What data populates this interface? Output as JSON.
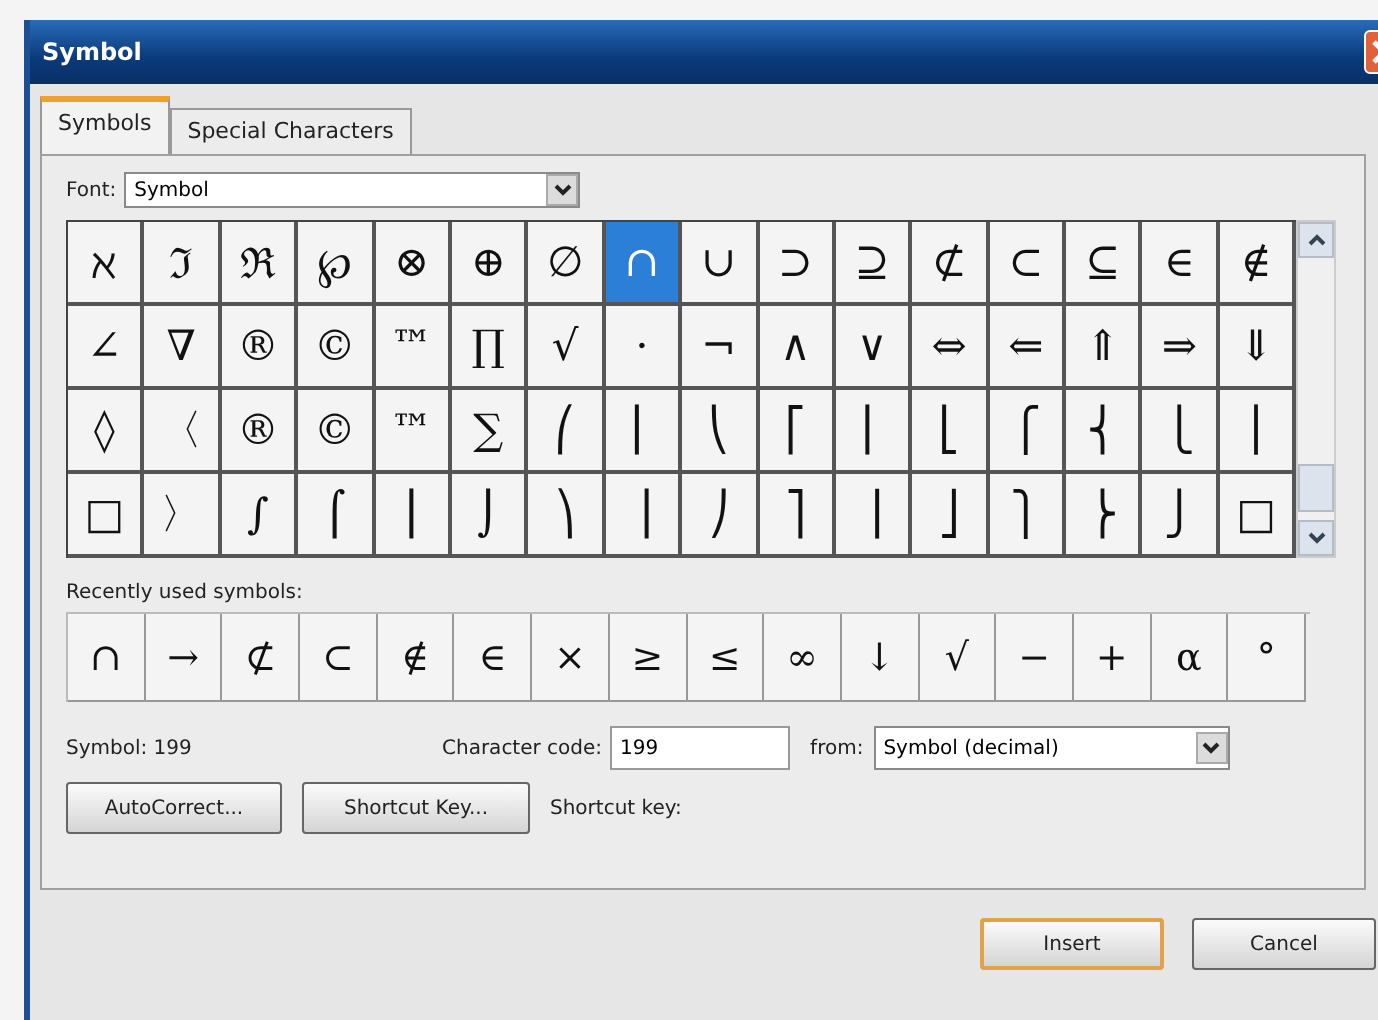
{
  "window": {
    "title": "Symbol"
  },
  "tabs": [
    {
      "label": "Symbols",
      "selected": true
    },
    {
      "label": "Special Characters",
      "selected": false
    }
  ],
  "font": {
    "label": "Font:",
    "value": "Symbol"
  },
  "symbol_grid": [
    [
      {
        "char": "ℵ",
        "selected": false
      },
      {
        "char": "ℑ",
        "selected": false
      },
      {
        "char": "ℜ",
        "selected": false
      },
      {
        "char": "℘",
        "selected": false
      },
      {
        "char": "⊗",
        "selected": false
      },
      {
        "char": "⊕",
        "selected": false
      },
      {
        "char": "∅",
        "selected": false
      },
      {
        "char": "∩",
        "selected": true
      },
      {
        "char": "∪",
        "selected": false
      },
      {
        "char": "⊃",
        "selected": false
      },
      {
        "char": "⊇",
        "selected": false
      },
      {
        "char": "⊄",
        "selected": false
      },
      {
        "char": "⊂",
        "selected": false
      },
      {
        "char": "⊆",
        "selected": false
      },
      {
        "char": "∈",
        "selected": false
      },
      {
        "char": "∉",
        "selected": false
      }
    ],
    [
      {
        "char": "∠",
        "selected": false
      },
      {
        "char": "∇",
        "selected": false
      },
      {
        "char": "®",
        "selected": false
      },
      {
        "char": "©",
        "selected": false
      },
      {
        "char": "™",
        "selected": false
      },
      {
        "char": "∏",
        "selected": false
      },
      {
        "char": "√",
        "selected": false
      },
      {
        "char": "⋅",
        "selected": false
      },
      {
        "char": "¬",
        "selected": false
      },
      {
        "char": "∧",
        "selected": false
      },
      {
        "char": "∨",
        "selected": false
      },
      {
        "char": "⇔",
        "selected": false
      },
      {
        "char": "⇐",
        "selected": false
      },
      {
        "char": "⇑",
        "selected": false
      },
      {
        "char": "⇒",
        "selected": false
      },
      {
        "char": "⇓",
        "selected": false
      }
    ],
    [
      {
        "char": "◊",
        "selected": false
      },
      {
        "char": "〈",
        "selected": false
      },
      {
        "char": "®",
        "selected": false
      },
      {
        "char": "©",
        "selected": false
      },
      {
        "char": "™",
        "selected": false
      },
      {
        "char": "∑",
        "selected": false
      },
      {
        "char": "⎛",
        "selected": false
      },
      {
        "char": "⎜",
        "selected": false
      },
      {
        "char": "⎝",
        "selected": false
      },
      {
        "char": "⎡",
        "selected": false
      },
      {
        "char": "⎢",
        "selected": false
      },
      {
        "char": "⎣",
        "selected": false
      },
      {
        "char": "⎧",
        "selected": false
      },
      {
        "char": "⎨",
        "selected": false
      },
      {
        "char": "⎩",
        "selected": false
      },
      {
        "char": "⎪",
        "selected": false
      }
    ],
    [
      {
        "char": "□",
        "selected": false
      },
      {
        "char": "〉",
        "selected": false
      },
      {
        "char": "∫",
        "selected": false
      },
      {
        "char": "⌠",
        "selected": false
      },
      {
        "char": "⎮",
        "selected": false
      },
      {
        "char": "⌡",
        "selected": false
      },
      {
        "char": "⎞",
        "selected": false
      },
      {
        "char": "⎟",
        "selected": false
      },
      {
        "char": "⎠",
        "selected": false
      },
      {
        "char": "⎤",
        "selected": false
      },
      {
        "char": "⎥",
        "selected": false
      },
      {
        "char": "⎦",
        "selected": false
      },
      {
        "char": "⎫",
        "selected": false
      },
      {
        "char": "⎬",
        "selected": false
      },
      {
        "char": "⎭",
        "selected": false
      },
      {
        "char": "□",
        "selected": false
      }
    ]
  ],
  "recently_used": {
    "label": "Recently used symbols:",
    "symbols": [
      "∩",
      "→",
      "⊄",
      "⊂",
      "∉",
      "∈",
      "×",
      "≥",
      "≤",
      "∞",
      "↓",
      "√",
      "−",
      "+",
      "α",
      "°"
    ]
  },
  "symbol_info": "Symbol: 199",
  "character_code": {
    "label": "Character code:",
    "value": "199"
  },
  "from": {
    "label": "from:",
    "value": "Symbol (decimal)"
  },
  "panel_buttons": [
    "AutoCorrect...",
    "Shortcut Key..."
  ],
  "shortcut_key_label": "Shortcut key:",
  "dialog_buttons": [
    {
      "label": "Insert",
      "default": true
    },
    {
      "label": "Cancel",
      "default": false
    }
  ]
}
